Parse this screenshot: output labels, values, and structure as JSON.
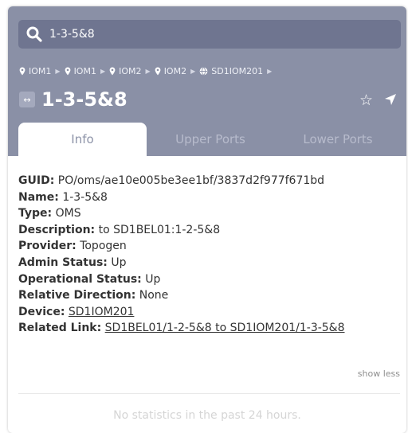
{
  "search": {
    "value": "1-3-5&8"
  },
  "breadcrumb": [
    {
      "label": "IOM1",
      "icon": "map-pin-icon"
    },
    {
      "label": "IOM1",
      "icon": "map-pin-icon"
    },
    {
      "label": "IOM2",
      "icon": "map-pin-icon"
    },
    {
      "label": "IOM2",
      "icon": "map-pin-icon"
    },
    {
      "label": "SD1IOM201",
      "icon": "globe-icon"
    }
  ],
  "entity": {
    "title": "1-3-5&8",
    "badge": "↔"
  },
  "tabs": [
    "Info",
    "Upper Ports",
    "Lower Ports"
  ],
  "details": {
    "guid_label": "GUID:",
    "guid": "PO/oms/ae10e005be3ee1bf/3837d2f977f671bd",
    "name_label": "Name:",
    "name": "1-3-5&8",
    "type_label": "Type:",
    "type": "OMS",
    "description_label": "Description:",
    "description": "to SD1BEL01:1-2-5&8",
    "provider_label": "Provider:",
    "provider": "Topogen",
    "admin_status_label": "Admin Status:",
    "admin_status": "Up",
    "operational_status_label": "Operational Status:",
    "operational_status": "Up",
    "relative_direction_label": "Relative Direction:",
    "relative_direction": "None",
    "device_label": "Device:",
    "device": "SD1IOM201",
    "related_link_label": "Related Link:",
    "related_link": "SD1BEL01/1-2-5&8 to SD1IOM201/1-3-5&8"
  },
  "show_less": "show less",
  "stats_empty": "No statistics in the past 24 hours.",
  "colors": {
    "header": "#8a90a6",
    "search": "#6f7590"
  }
}
